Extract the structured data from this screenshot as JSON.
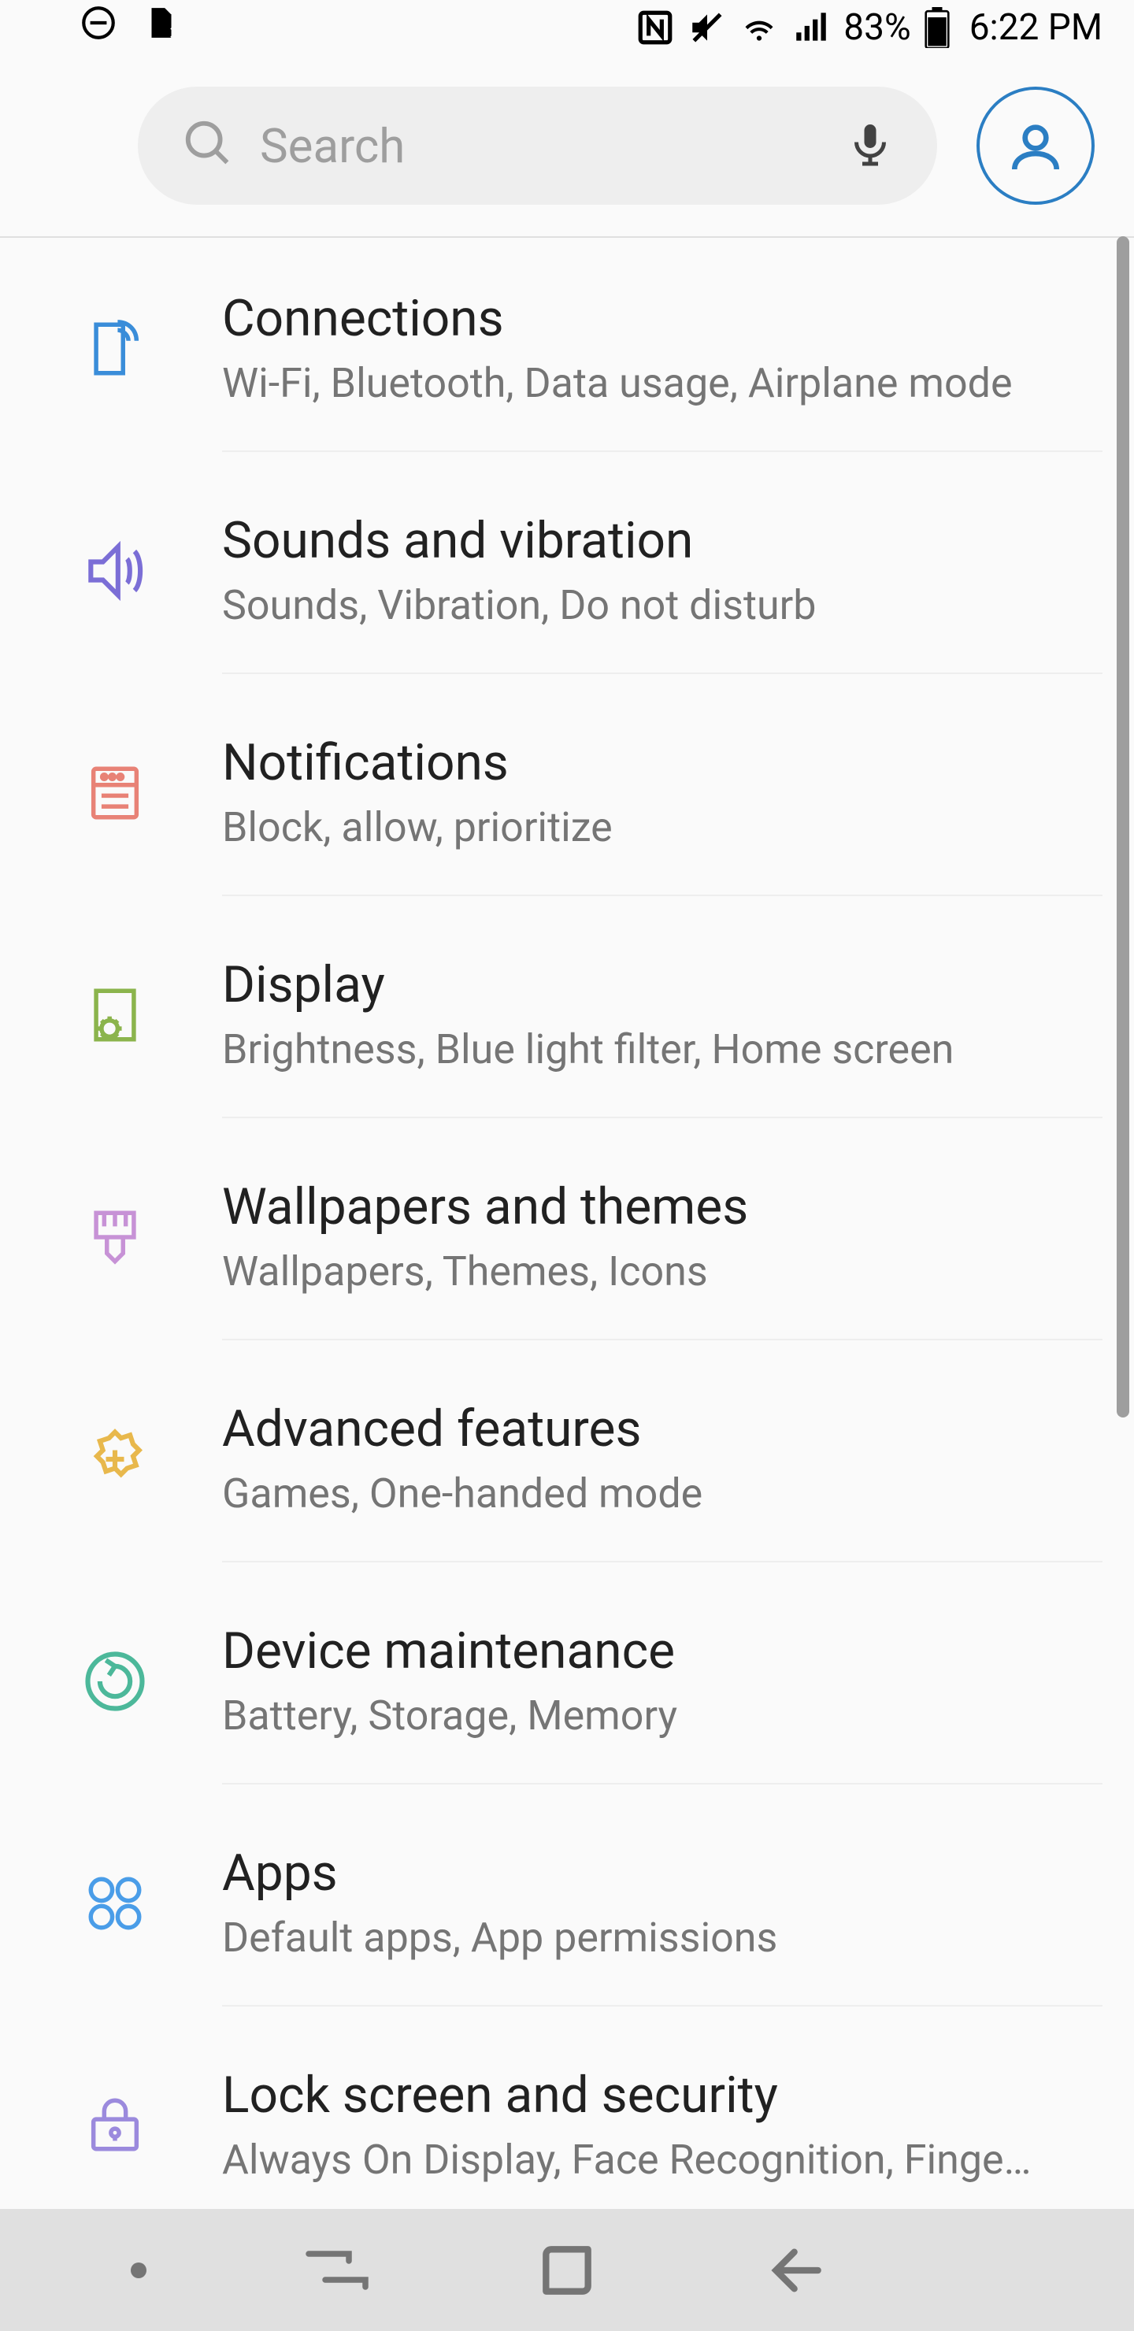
{
  "status": {
    "battery": "83%",
    "time": "6:22 PM"
  },
  "search": {
    "placeholder": "Search"
  },
  "items": [
    {
      "title": "Connections",
      "subtitle": "Wi-Fi, Bluetooth, Data usage, Airplane mode",
      "icon": "connections",
      "color": "#3a8dd9"
    },
    {
      "title": "Sounds and vibration",
      "subtitle": "Sounds, Vibration, Do not disturb",
      "icon": "sound",
      "color": "#7b6ed6"
    },
    {
      "title": "Notifications",
      "subtitle": "Block, allow, prioritize",
      "icon": "notifications",
      "color": "#e88276"
    },
    {
      "title": "Display",
      "subtitle": "Brightness, Blue light filter, Home screen",
      "icon": "display",
      "color": "#8bb44c"
    },
    {
      "title": "Wallpapers and themes",
      "subtitle": "Wallpapers, Themes, Icons",
      "icon": "themes",
      "color": "#c792d6"
    },
    {
      "title": "Advanced features",
      "subtitle": "Games, One-handed mode",
      "icon": "advanced",
      "color": "#e8b84c"
    },
    {
      "title": "Device maintenance",
      "subtitle": "Battery, Storage, Memory",
      "icon": "maintenance",
      "color": "#4cb89a"
    },
    {
      "title": "Apps",
      "subtitle": "Default apps, App permissions",
      "icon": "apps",
      "color": "#4a9de8"
    },
    {
      "title": "Lock screen and security",
      "subtitle": "Always On Display, Face Recognition, Finge…",
      "icon": "lock",
      "color": "#9b8add"
    }
  ]
}
